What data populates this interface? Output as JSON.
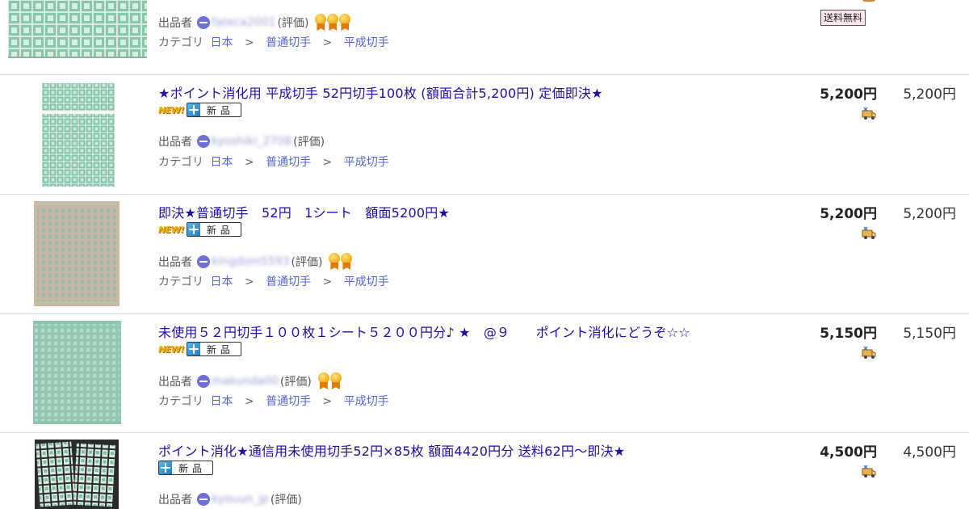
{
  "top_partial": {
    "seller_label": "出品者",
    "seller_id": "fateca2001",
    "rating_label": "(評価)",
    "medal_count": 3,
    "category_label": "カテゴリ",
    "category": [
      "日本",
      "普通切手",
      "平成切手"
    ],
    "free_shipping_label": "送料無料"
  },
  "separator": ">",
  "listings": [
    {
      "title": "★ポイント消化用 平成切手 52円切手100枚 (額面合計5,200円) 定価即決★",
      "is_new": true,
      "new_label": "NEW!",
      "condition": "新品",
      "seller_label": "出品者",
      "seller_id": "kyoshiki_2708",
      "rating_label": "(評価)",
      "medal_count": 0,
      "category_label": "カテゴリ",
      "category": [
        "日本",
        "普通切手",
        "平成切手"
      ],
      "current_price": "5,200円",
      "buyout_price": "5,200円"
    },
    {
      "title": "即決★普通切手　52円　1シート　額面5200円★",
      "is_new": true,
      "new_label": "NEW!",
      "condition": "新品",
      "seller_label": "出品者",
      "seller_id": "kingdom5593",
      "rating_label": "(評価)",
      "medal_count": 2,
      "category_label": "カテゴリ",
      "category": [
        "日本",
        "普通切手",
        "平成切手"
      ],
      "current_price": "5,200円",
      "buyout_price": "5,200円"
    },
    {
      "title": "未使用５２円切手１００枚１シート５２００円分♪ ★　@９　　ポイント消化にどうぞ☆☆",
      "is_new": true,
      "new_label": "NEW!",
      "condition": "新品",
      "seller_label": "出品者",
      "seller_id": "makunda00",
      "rating_label": "(評価)",
      "medal_count": 2,
      "category_label": "カテゴリ",
      "category": [
        "日本",
        "普通切手",
        "平成切手"
      ],
      "current_price": "5,150円",
      "buyout_price": "5,150円"
    },
    {
      "title": "ポイント消化★通信用未使用切手52円×85枚 額面4420円分 送料62円～即決★",
      "is_new": false,
      "new_label": "",
      "condition": "新品",
      "seller_label": "出品者",
      "seller_id": "kyouun_jp",
      "rating_label": "(評価)",
      "medal_count": 0,
      "category_label": "カテゴリ",
      "category": [
        "日本",
        "普通切手",
        "平成切手"
      ],
      "current_price": "4,500円",
      "buyout_price": "4,500円"
    }
  ],
  "colors": {
    "link": "#1a0dab",
    "category_link": "#5566cc",
    "free_shipping_bg": "#fde7ec",
    "stamp_green": "#7cc4a4"
  }
}
